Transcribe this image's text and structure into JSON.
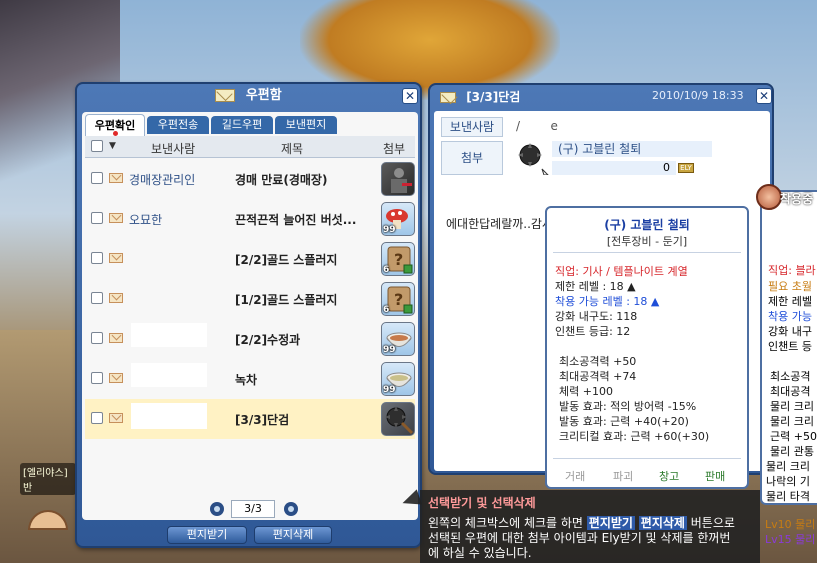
{
  "scene": {
    "npc_label": "[엘리야스]\n반"
  },
  "mailbox": {
    "title": "우편함",
    "tabs": [
      "우편확인",
      "우편전송",
      "길드우편",
      "보낸편지"
    ],
    "columns": {
      "sender": "보낸사람",
      "subject": "제목",
      "attach": "첨부"
    },
    "rows": [
      {
        "sender": "경매장관리인",
        "subject": "경매 만료(경매장)",
        "qty": ""
      },
      {
        "sender": "오묘한",
        "subject": "끈적끈적 늘어진 버섯...",
        "qty": "99"
      },
      {
        "sender": "",
        "subject": "[2/2]골드 스플러지",
        "qty": "6"
      },
      {
        "sender": "",
        "subject": "[1/2]골드 스플러지",
        "qty": "6"
      },
      {
        "sender": "",
        "subject": "[2/2]수정과",
        "qty": "99"
      },
      {
        "sender": "",
        "subject": "녹차",
        "qty": "99"
      },
      {
        "sender": "",
        "subject": "[3/3]단검",
        "qty": ""
      }
    ],
    "pager": "3/3",
    "buttons": {
      "receive": "편지받기",
      "delete": "편지삭제"
    }
  },
  "letter": {
    "title": "[3/3]단검",
    "date": "2010/10/9 18:33",
    "sender_label": "보낸사람",
    "sender_value": "/        e",
    "attach_label": "첨부",
    "item_name": "(구) 고블린 철퇴",
    "ely": "0",
    "ely_tag": "ELY",
    "body": "에대한답례랄까..감사하게받을께여ㅠㅠ"
  },
  "tooltip": {
    "title": "(구) 고블린 철퇴",
    "category": "[전투장비 - 둔기]",
    "job": "직업: 기사 / 템플나이트 계열",
    "level_limit": "제한 레벨 : 18 ▲",
    "equip_level": "착용 가능 레벨 : 18 ▲",
    "durability": "강화 내구도: 118",
    "enchant": "인챈트 등급: 12",
    "stats": [
      "최소공격력 +50",
      "최대공격력 +74",
      "체력 +100",
      "발동 효과: 적의 방어력 -15%",
      "발동 효과: 근력 +40(+20)",
      "크리티컬 효과: 근력 +60(+30)"
    ],
    "actions": [
      "거래",
      "파괴",
      "창고",
      "판매"
    ]
  },
  "tooltip2": {
    "badge": "착용중",
    "lines": [
      "직업: 블라",
      "필요 초월",
      "제한 레벨",
      "착용 가능",
      "강화 내구",
      "인챈트 등",
      "최소공격",
      "최대공격",
      "물리 크리",
      "물리 크리",
      "근력 +50",
      "물리 관통",
      "물리 크리",
      "나락의 기",
      "물리 타격",
      "Lv10 물리",
      "Lv15 물리"
    ]
  },
  "guide": {
    "title": "선택받기 및 선택삭제",
    "line1_a": "왼쪽의 체크박스에 체크를 하면 ",
    "line1_b": "편지받기",
    "line1_c": "편지삭제",
    "line1_d": " 버튼으로",
    "line2": "선택된 우편에 대한 첨부 아이템과 Ely받기 및 삭제를 한꺼번",
    "line3": "에 하실 수 있습니다."
  }
}
